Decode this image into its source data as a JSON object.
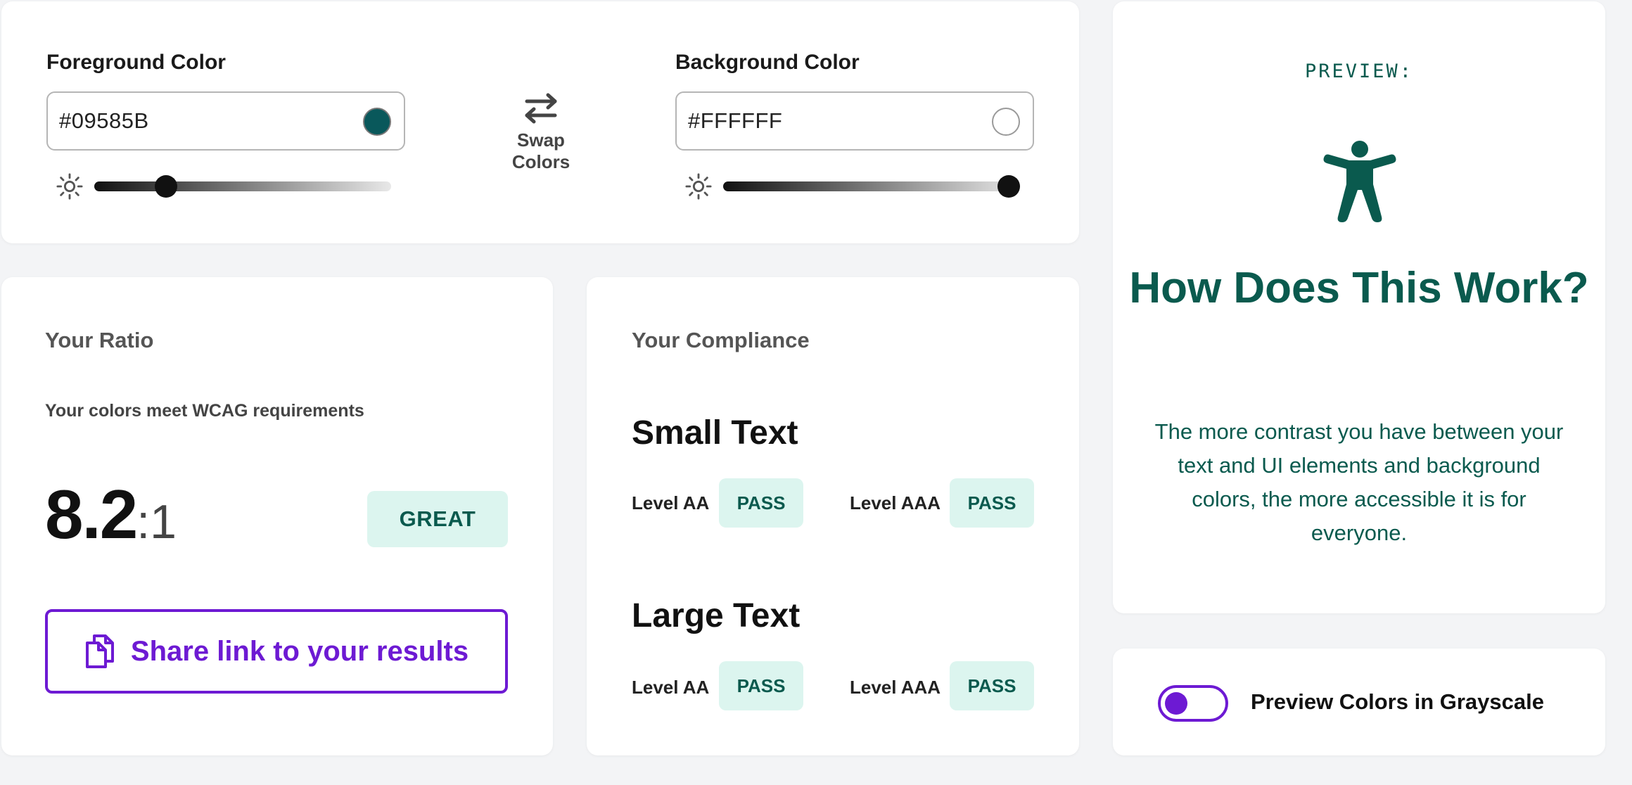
{
  "foreground": {
    "label": "Foreground Color",
    "value": "#09585B",
    "swatch_color": "#09585B",
    "brightness_fraction": 0.22
  },
  "background": {
    "label": "Background Color",
    "value": "#FFFFFF",
    "swatch_color": "#FFFFFF",
    "brightness_fraction": 1.0
  },
  "swap": {
    "label": "Swap Colors",
    "icon": "swap-arrows-icon"
  },
  "ratio": {
    "title": "Your Ratio",
    "subtitle": "Your colors meet WCAG requirements",
    "value": "8.2",
    "suffix": ":1",
    "rating": "GREAT",
    "share_label": "Share link to your results",
    "share_icon": "copy-icon"
  },
  "compliance": {
    "title": "Your Compliance",
    "small": {
      "heading": "Small Text",
      "aa_label": "Level AA",
      "aa_result": "PASS",
      "aaa_label": "Level AAA",
      "aaa_result": "PASS"
    },
    "large": {
      "heading": "Large Text",
      "aa_label": "Level AA",
      "aa_result": "PASS",
      "aaa_label": "Level AAA",
      "aaa_result": "PASS"
    }
  },
  "preview": {
    "label": "PREVIEW:",
    "icon": "accessibility-person-icon",
    "title": "How Does This Work?",
    "body": "The more contrast you have between your text and UI elements and background colors, the more accessible it is for everyone."
  },
  "grayscale": {
    "label": "Preview Colors in Grayscale",
    "enabled": false
  },
  "colors": {
    "accent_purple": "#6D1AD3",
    "teal_text": "#0A5A4E",
    "badge_bg": "#DCF5EF"
  }
}
